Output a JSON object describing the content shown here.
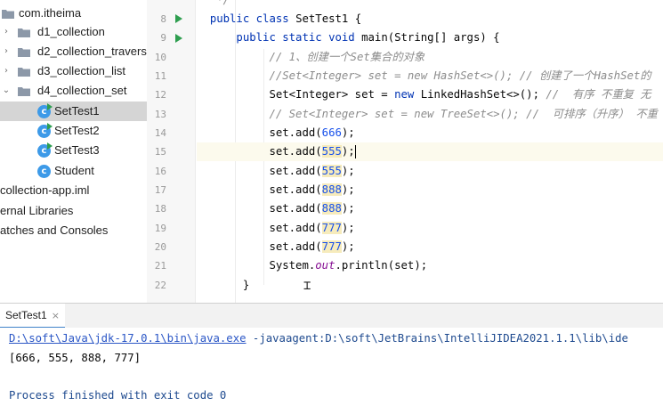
{
  "tree": {
    "root_label": "com.itheima",
    "items": [
      {
        "label": "d1_collection",
        "kind": "folder",
        "expanded": false
      },
      {
        "label": "d2_collection_travers",
        "kind": "folder",
        "expanded": false
      },
      {
        "label": "d3_collection_list",
        "kind": "folder",
        "expanded": false
      },
      {
        "label": "d4_collection_set",
        "kind": "folder",
        "expanded": true
      },
      {
        "label": "SetTest1",
        "kind": "class-run",
        "selected": true
      },
      {
        "label": "SetTest2",
        "kind": "class-run"
      },
      {
        "label": "SetTest3",
        "kind": "class-run"
      },
      {
        "label": "Student",
        "kind": "class"
      }
    ],
    "iml_label": "collection-app.iml",
    "libraries_label": "ernal Libraries",
    "scratches_label": "atches and Consoles"
  },
  "editor": {
    "line_numbers": [
      "8",
      "9",
      "10",
      "11",
      "12",
      "13",
      "14",
      "15",
      "16",
      "17",
      "18",
      "19",
      "20",
      "21",
      "22"
    ],
    "current_line": "15",
    "top_fragment": "*/"
  },
  "code": {
    "l8": {
      "kw1": "public",
      "kw2": "class",
      "rest": " SetTest1 {"
    },
    "l9": {
      "kw1": "public",
      "kw2": "static",
      "kw3": "void",
      "rest": " main(String[] args) {"
    },
    "l10": "// 1、创建一个Set集合的对象",
    "l11": "//Set<Integer> set = new HashSet<>(); // 创建了一个HashSet的",
    "l12": {
      "pre": "Set<Integer> set = ",
      "kw": "new",
      "post": " LinkedHashSet<>(); ",
      "cmt": "//  有序 不重复 无"
    },
    "l13": "// Set<Integer> set = new TreeSet<>(); //  可排序（升序） 不重",
    "adds": [
      {
        "pre": "set.add(",
        "num": "666",
        "post": ");"
      },
      {
        "pre": "set.add(",
        "num": "555",
        "post": ");"
      },
      {
        "pre": "set.add(",
        "num": "555",
        "post": ");"
      },
      {
        "pre": "set.add(",
        "num": "888",
        "post": ");"
      },
      {
        "pre": "set.add(",
        "num": "888",
        "post": ");"
      },
      {
        "pre": "set.add(",
        "num": "777",
        "post": ");"
      },
      {
        "pre": "set.add(",
        "num": "777",
        "post": ");"
      }
    ],
    "l21": {
      "pre": "System.",
      "field": "out",
      "post": ".println(set);"
    },
    "l22": "}"
  },
  "run": {
    "tab_label": "SetTest1",
    "tab_close": "×",
    "command_path": "D:\\soft\\Java\\jdk-17.0.1\\bin\\java.exe",
    "command_args": " -javaagent:D:\\soft\\JetBrains\\IntelliJIDEA2021.1.1\\lib\\ide",
    "output": "[666, 555, 888, 777]",
    "exit": "Process finished with exit code 0"
  }
}
